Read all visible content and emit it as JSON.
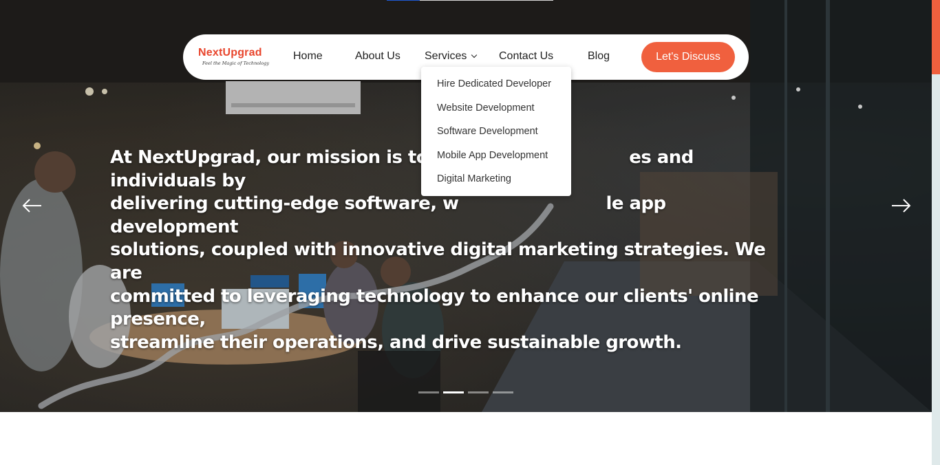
{
  "brand": {
    "name": "NextUpgrad",
    "tagline": "Feel the Magic of Technology",
    "accent_color": "#f0603e"
  },
  "nav": {
    "items": [
      {
        "label": "Home"
      },
      {
        "label": "About Us"
      },
      {
        "label": "Services"
      },
      {
        "label": "Contact Us"
      },
      {
        "label": "Blog"
      }
    ],
    "cta_label": "Let's Discuss"
  },
  "services_menu": {
    "items": [
      {
        "label": "Hire Dedicated Developer"
      },
      {
        "label": "Website Development"
      },
      {
        "label": "Software Development"
      },
      {
        "label": "Mobile App Development"
      },
      {
        "label": "Digital Marketing"
      }
    ]
  },
  "hero": {
    "line1_a": "At NextUpgrad, our mission is to em",
    "line1_b": "es and individuals by",
    "line2_a": "delivering cutting-edge software, w",
    "line2_b": "le app development",
    "line3": "solutions, coupled with innovative digital marketing strategies. We are",
    "line4": "committed to leveraging technology to enhance our clients' online presence,",
    "line5": "streamline their operations, and drive sustainable growth.",
    "prev_icon": "arrow-left-icon",
    "next_icon": "arrow-right-icon",
    "slides_total": 4,
    "active_slide": 2
  }
}
